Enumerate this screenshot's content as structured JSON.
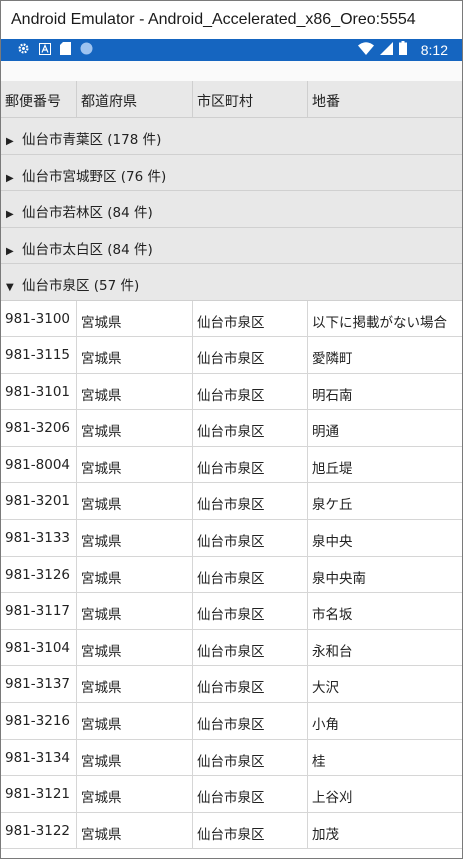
{
  "window": {
    "title": "Android Emulator - Android_Accelerated_x86_Oreo:5554"
  },
  "status_bar": {
    "time": "8:12",
    "left_icons": [
      "gear-icon",
      "a-icon",
      "sd-card-icon",
      "circle-icon"
    ],
    "right_icons": [
      "wifi-icon",
      "signal-icon",
      "battery-icon"
    ],
    "color": "#1565c0"
  },
  "table": {
    "headers": [
      "郵便番号",
      "都道府県",
      "市区町村",
      "地番"
    ],
    "groups": [
      {
        "label": "仙台市青葉区 (178 件)",
        "expanded": false,
        "arrow": "▶"
      },
      {
        "label": "仙台市宮城野区 (76 件)",
        "expanded": false,
        "arrow": "▶"
      },
      {
        "label": "仙台市若林区 (84 件)",
        "expanded": false,
        "arrow": "▶"
      },
      {
        "label": "仙台市太白区 (84 件)",
        "expanded": false,
        "arrow": "▶"
      },
      {
        "label": "仙台市泉区 (57 件)",
        "expanded": true,
        "arrow": "▼"
      }
    ],
    "rows": [
      [
        "981-3100",
        "宮城県",
        "仙台市泉区",
        "以下に掲載がない場合"
      ],
      [
        "981-3115",
        "宮城県",
        "仙台市泉区",
        "愛隣町"
      ],
      [
        "981-3101",
        "宮城県",
        "仙台市泉区",
        "明石南"
      ],
      [
        "981-3206",
        "宮城県",
        "仙台市泉区",
        "明通"
      ],
      [
        "981-8004",
        "宮城県",
        "仙台市泉区",
        "旭丘堤"
      ],
      [
        "981-3201",
        "宮城県",
        "仙台市泉区",
        "泉ケ丘"
      ],
      [
        "981-3133",
        "宮城県",
        "仙台市泉区",
        "泉中央"
      ],
      [
        "981-3126",
        "宮城県",
        "仙台市泉区",
        "泉中央南"
      ],
      [
        "981-3117",
        "宮城県",
        "仙台市泉区",
        "市名坂"
      ],
      [
        "981-3104",
        "宮城県",
        "仙台市泉区",
        "永和台"
      ],
      [
        "981-3137",
        "宮城県",
        "仙台市泉区",
        "大沢"
      ],
      [
        "981-3216",
        "宮城県",
        "仙台市泉区",
        "小角"
      ],
      [
        "981-3134",
        "宮城県",
        "仙台市泉区",
        "桂"
      ],
      [
        "981-3121",
        "宮城県",
        "仙台市泉区",
        "上谷刈"
      ],
      [
        "981-3122",
        "宮城県",
        "仙台市泉区",
        "加茂"
      ]
    ]
  }
}
